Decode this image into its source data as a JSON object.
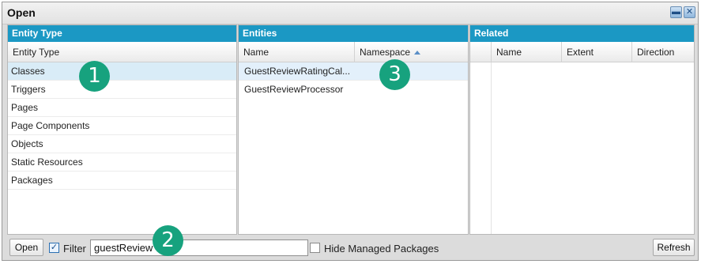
{
  "window": {
    "title": "Open"
  },
  "entity_type_panel": {
    "header": "Entity Type",
    "column": "Entity Type",
    "items": [
      "Classes",
      "Triggers",
      "Pages",
      "Page Components",
      "Objects",
      "Static Resources",
      "Packages"
    ],
    "selected": "Classes"
  },
  "entities_panel": {
    "header": "Entities",
    "columns": [
      "Name",
      "Namespace"
    ],
    "rows": [
      {
        "name": "GuestReviewRatingCal...",
        "namespace": ""
      },
      {
        "name": "GuestReviewProcessor",
        "namespace": ""
      }
    ]
  },
  "related_panel": {
    "header": "Related",
    "columns": [
      "Name",
      "Extent",
      "Direction"
    ]
  },
  "bottom": {
    "open_label": "Open",
    "filter_label": "Filter",
    "filter_checked": true,
    "filter_value": "guestReview",
    "hide_managed_label": "Hide Managed Packages",
    "hide_managed_checked": false,
    "refresh_label": "Refresh"
  },
  "annotations": [
    "1",
    "2",
    "3"
  ],
  "colors": {
    "header_blue": "#1b98c4",
    "badge_green": "#17a27e",
    "selected_row": "#d9ecf7"
  }
}
